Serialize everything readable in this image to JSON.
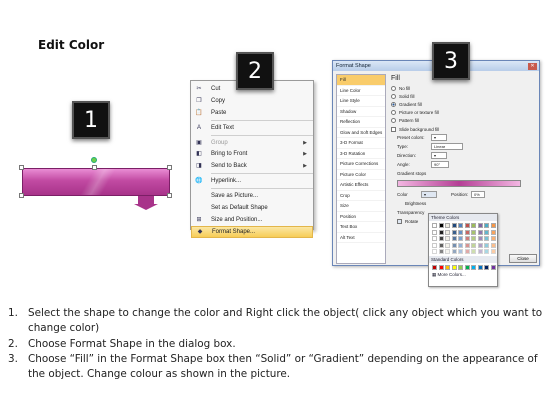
{
  "title": "Edit Color",
  "badges": [
    "1",
    "2",
    "3"
  ],
  "colors": {
    "accent": "#a8338a",
    "menu_highlight": "#f7cd57",
    "nav_active": "#f9cc6b"
  },
  "context_menu": {
    "items": [
      {
        "label": "Cut",
        "icon": "scissors-icon"
      },
      {
        "label": "Copy",
        "icon": "copy-icon"
      },
      {
        "label": "Paste",
        "icon": "paste-icon"
      },
      {
        "label": "Edit Text",
        "icon": "edit-text-icon"
      },
      {
        "label": "Group",
        "icon": "group-icon",
        "disabled": true
      },
      {
        "label": "Bring to Front",
        "icon": "bring-front-icon"
      },
      {
        "label": "Send to Back",
        "icon": "send-back-icon"
      },
      {
        "label": "Hyperlink...",
        "icon": "hyperlink-icon"
      },
      {
        "label": "Save as Picture...",
        "icon": ""
      },
      {
        "label": "Set as Default Shape",
        "icon": ""
      },
      {
        "label": "Size and Position...",
        "icon": "size-icon"
      },
      {
        "label": "Format Shape...",
        "icon": "format-shape-icon"
      }
    ]
  },
  "dialog": {
    "title": "Format Shape",
    "nav": [
      "Fill",
      "Line Color",
      "Line Style",
      "Shadow",
      "Reflection",
      "Glow and Soft Edges",
      "3-D Format",
      "3-D Rotation",
      "Picture Corrections",
      "Picture Color",
      "Artistic Effects",
      "Crop",
      "Size",
      "Position",
      "Text Box",
      "Alt Text"
    ],
    "section": "Fill",
    "options": [
      "No fill",
      "Solid fill",
      "Gradient fill",
      "Picture or texture fill",
      "Pattern fill",
      "Slide background fill"
    ],
    "fields": {
      "preset_label": "Preset colors:",
      "type_label": "Type:",
      "type_value": "Linear",
      "direction_label": "Direction:",
      "angle_label": "Angle:",
      "angle_value": "90°",
      "stops_label": "Gradient stops",
      "color_label": "Color",
      "position_label": "Position:",
      "position_value": "0%",
      "brightness_label": "Brightness",
      "transparency_label": "Transparency",
      "rotate_label": "Rotate"
    },
    "close_label": "Close"
  },
  "palette": {
    "theme_label": "Theme Colors",
    "standard_label": "Standard Colors",
    "more_label": "More Colors..."
  },
  "instructions": [
    {
      "num": "1.",
      "text": "Select the shape to change the color and Right click the object( click any object which you want to change color)"
    },
    {
      "num": "2.",
      "text": "Choose Format Shape in the dialog box."
    },
    {
      "num": "3.",
      "text": "Choose “Fill” in the Format Shape box then “Solid” or “Gradient” depending on the appearance of the object. Change colour as shown in the picture."
    }
  ]
}
